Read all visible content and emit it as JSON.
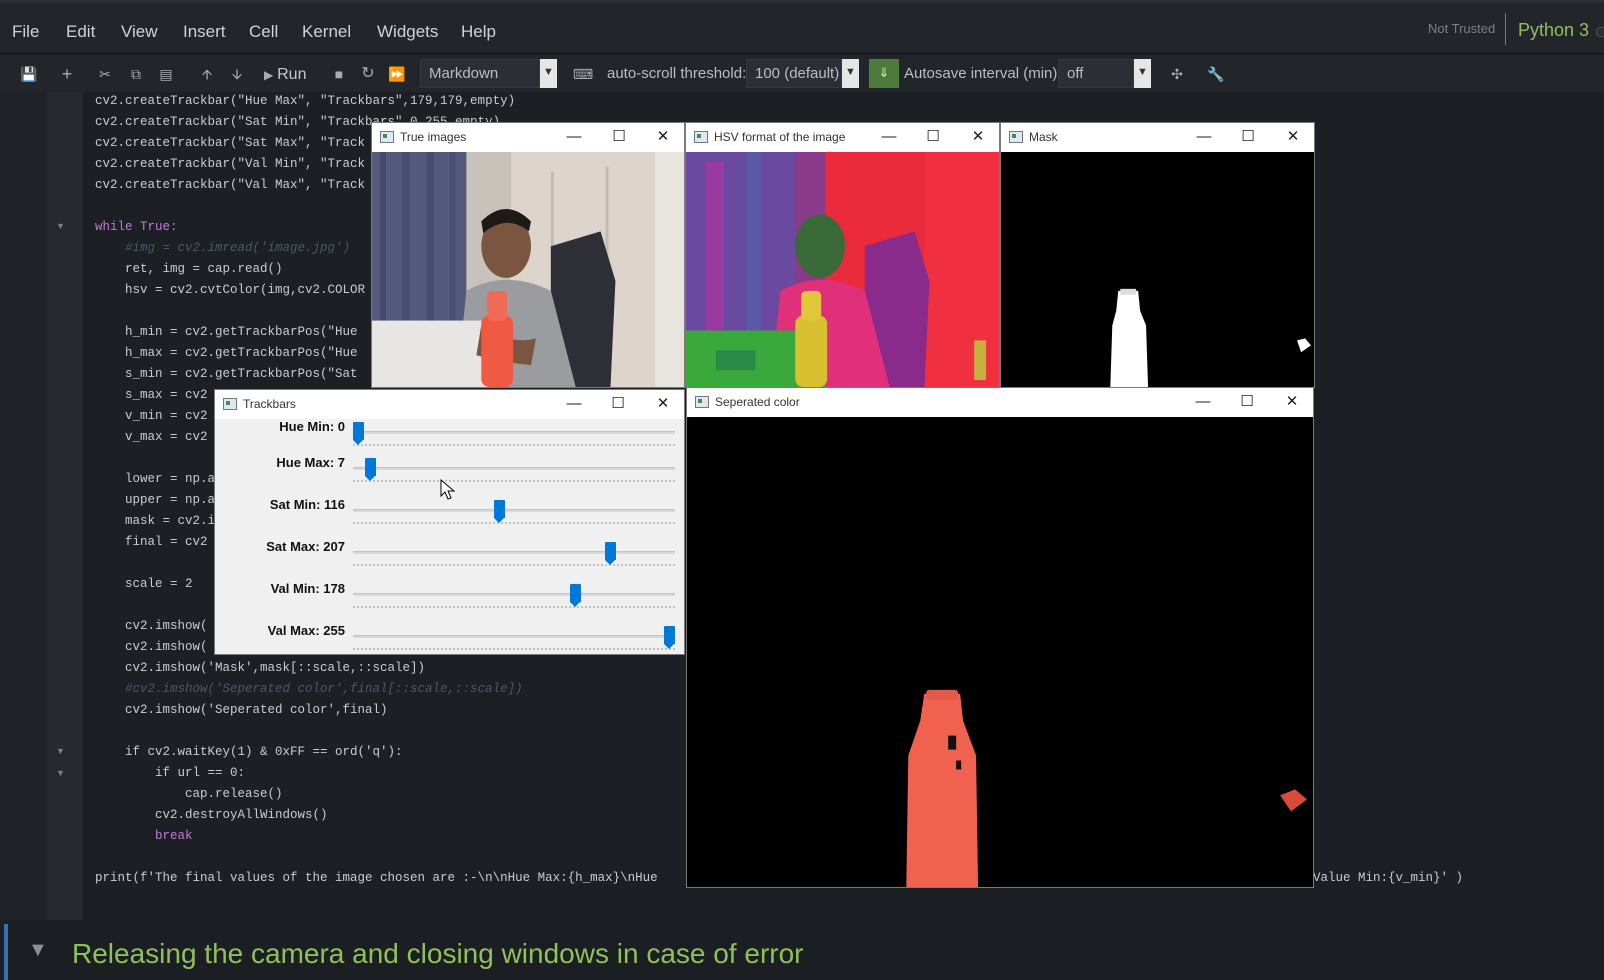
{
  "menubar": {
    "items": [
      "File",
      "Edit",
      "View",
      "Insert",
      "Cell",
      "Kernel",
      "Widgets",
      "Help"
    ],
    "trust_status": "Not Trusted",
    "kernel_name": "Python 3"
  },
  "toolbar": {
    "run_label": "Run",
    "cell_type": "Markdown",
    "autoscroll_label": "auto-scroll threshold:",
    "autoscroll_value": "100 (default)",
    "autosave_label": "Autosave interval (min):",
    "autosave_value": "off"
  },
  "code": {
    "l0": "cv2.createTrackbar(\"Hue Max\", \"Trackbars\",179,179,empty)",
    "l1": "cv2.createTrackbar(\"Sat Min\", \"Trackbars\",0,255,empty)",
    "l2": "cv2.createTrackbar(\"Sat Max\", \"Track",
    "l3": "cv2.createTrackbar(\"Val Min\", \"Track",
    "l4": "cv2.createTrackbar(\"Val Max\", \"Track",
    "l6": "while True:",
    "l7": "    #img = cv2.imread('image.jpg')",
    "l8": "    ret, img = cap.read()",
    "l9": "    hsv = cv2.cvtColor(img,cv2.COLOR",
    "l11": "    h_min = cv2.getTrackbarPos(\"Hue",
    "l12": "    h_max = cv2.getTrackbarPos(\"Hue",
    "l13": "    s_min = cv2.getTrackbarPos(\"Sat",
    "l14": "    s_max = cv2",
    "l15": "    v_min = cv2",
    "l16": "    v_max = cv2",
    "l18": "    lower = np.a",
    "l19": "    upper = np.a",
    "l20": "    mask = cv2.i",
    "l21": "    final = cv2",
    "l23": "    scale = 2",
    "l25": "    cv2.imshow(",
    "l26": "    cv2.imshow(",
    "l27": "    cv2.imshow('Mask',mask[::scale,::scale])",
    "l28": "    #cv2.imshow('Seperated color',final[::scale,::scale])",
    "l29": "    cv2.imshow('Seperated color',final)",
    "l31": "    if cv2.waitKey(1) & 0xFF == ord('q'):",
    "l32": "        if url == 0:",
    "l33": "            cap.release()",
    "l34": "        cv2.destroyAllWindows()",
    "l35": "        break",
    "l37": "print(f'The final values of the image chosen are :-\\n\\nHue Max:{h_max}\\nHue",
    "l37b": "Value Min:{v_min}' )"
  },
  "markdown_heading": "Releasing the camera and closing windows in case of error",
  "windows": {
    "true_images": "True images",
    "hsv": "HSV format of the image",
    "mask": "Mask",
    "trackbars": "Trackbars",
    "separated": "Seperated color"
  },
  "trackbars": [
    {
      "label": "Hue Min: 0",
      "value": 0,
      "max": 179
    },
    {
      "label": "Hue Max: 7",
      "value": 7,
      "max": 179
    },
    {
      "label": "Sat Min: 116",
      "value": 116,
      "max": 255
    },
    {
      "label": "Sat Max: 207",
      "value": 207,
      "max": 255
    },
    {
      "label": "Val Min: 178",
      "value": 178,
      "max": 255
    },
    {
      "label": "Val Max: 255",
      "value": 255,
      "max": 255
    }
  ],
  "colors": {
    "accent_green": "#8fc15b",
    "slider_blue": "#0078d7",
    "bottle_red": "#f0614f"
  }
}
